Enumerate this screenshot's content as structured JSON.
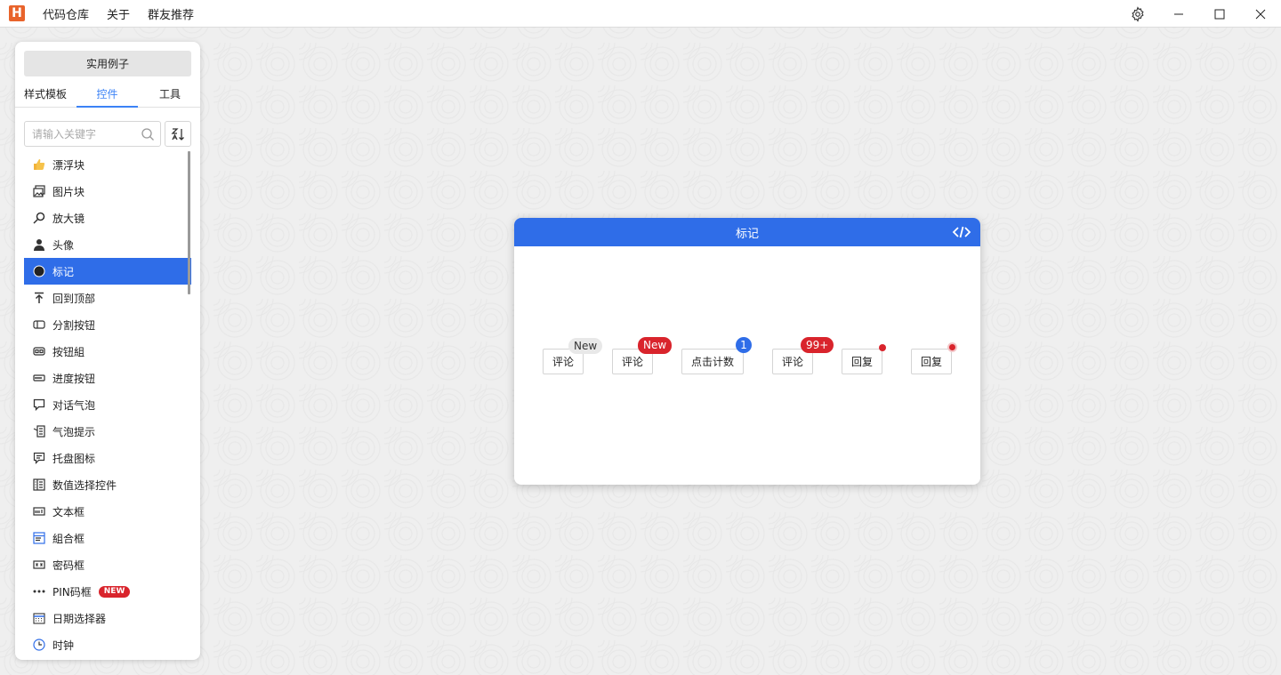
{
  "app": {
    "logo_letter": "H"
  },
  "menu": [
    "代码仓库",
    "关于",
    "群友推荐"
  ],
  "sidebar": {
    "examples_button": "实用例子",
    "tabs": [
      "样式模板",
      "控件",
      "工具"
    ],
    "active_tab": "控件",
    "search_placeholder": "请输入关键字",
    "items": [
      {
        "label": "漂浮块",
        "icon": "thumbs-up-icon"
      },
      {
        "label": "图片块",
        "icon": "image-block-icon"
      },
      {
        "label": "放大镜",
        "icon": "magnifier-icon"
      },
      {
        "label": "头像",
        "icon": "person-icon"
      },
      {
        "label": "标记",
        "icon": "circle-icon",
        "active": true
      },
      {
        "label": "回到顶部",
        "icon": "arrow-up-icon"
      },
      {
        "label": "分割按钮",
        "icon": "split-button-icon"
      },
      {
        "label": "按钮組",
        "icon": "button-group-icon"
      },
      {
        "label": "进度按钮",
        "icon": "progress-button-icon"
      },
      {
        "label": "对话气泡",
        "icon": "chat-bubble-icon"
      },
      {
        "label": "气泡提示",
        "icon": "tooltip-icon"
      },
      {
        "label": "托盘图标",
        "icon": "tray-icon"
      },
      {
        "label": "数值选择控件",
        "icon": "numeric-picker-icon"
      },
      {
        "label": "文本框",
        "icon": "textbox-icon"
      },
      {
        "label": "組合框",
        "icon": "combobox-icon"
      },
      {
        "label": "密码框",
        "icon": "password-icon"
      },
      {
        "label": "PIN码框",
        "icon": "dots-icon",
        "badge": "NEW"
      },
      {
        "label": "日期选择器",
        "icon": "calendar-icon"
      },
      {
        "label": "时钟",
        "icon": "clock-icon"
      }
    ]
  },
  "card": {
    "title": "标记",
    "buttons": [
      {
        "label": "评论",
        "mark": "New",
        "style": "gray"
      },
      {
        "label": "评论",
        "mark": "New",
        "style": "red"
      },
      {
        "label": "点击计数",
        "mark": "1",
        "style": "blue"
      },
      {
        "label": "评论",
        "mark": "99+",
        "style": "red"
      },
      {
        "label": "回复",
        "mark": "",
        "style": "dot"
      },
      {
        "label": "回复",
        "mark": "",
        "style": "dot-ring"
      }
    ]
  },
  "colors": {
    "accent": "#2f6de8",
    "badge_red": "#d9242c",
    "logo": "#e8632b"
  }
}
